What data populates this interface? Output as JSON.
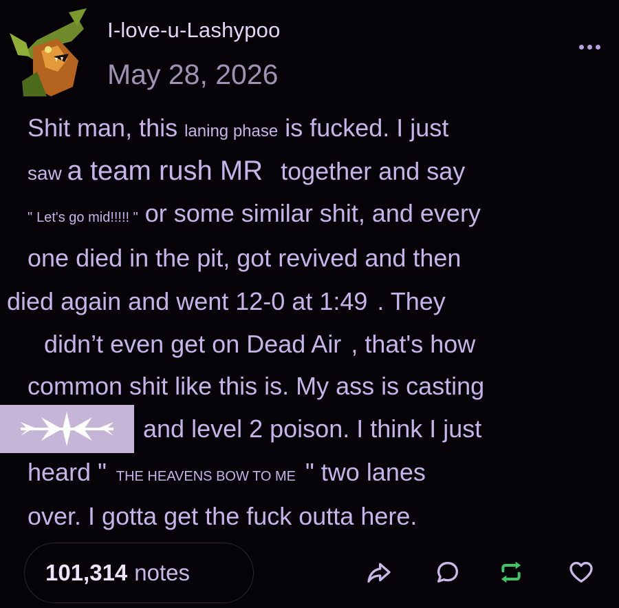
{
  "post": {
    "username": "I-love-u-Lashypoo",
    "date": "May 28, 2026",
    "body_lines": [
      [
        {
          "t": "Shit man, this ",
          "s": "n"
        },
        {
          "t": "laning phase",
          "s": "small"
        },
        {
          "t": " is fucked. I just",
          "s": "n"
        }
      ],
      [
        {
          "t": "saw ",
          "s": "small"
        },
        {
          "t": "a team rush MR",
          "s": "big"
        },
        {
          "t": "together and say",
          "s": "n"
        }
      ],
      [
        {
          "t": "\"",
          "s": "tiny"
        },
        {
          "t": "Let's go mid!!!!! \"",
          "s": "tiny"
        },
        {
          "t": "or some similar shit, and every",
          "s": "n"
        }
      ],
      [
        {
          "t": "one died in the pit, got revived and then",
          "s": "n"
        }
      ],
      [
        {
          "t": "died again and went 12-0 at 1:49",
          "s": "n"
        },
        {
          "t": ". They",
          "s": "n"
        }
      ],
      [
        {
          "t": "didn’t even get on Dead Air",
          "s": "n"
        },
        {
          "t": ", that's how",
          "s": "n"
        }
      ],
      [
        {
          "t": "common shit like this is. My ass is casting",
          "s": "n"
        }
      ],
      [
        {
          "t": "and level 2 poison. I think I just",
          "s": "n"
        }
      ],
      [
        {
          "t": "heard \"",
          "s": "n"
        },
        {
          "t": "THE HEAVENS BOW TO ME",
          "s": "tiny"
        },
        {
          "t": "\" two lanes",
          "s": "n"
        }
      ],
      [
        {
          "t": "over. I gotta get the fuck outta here.",
          "s": "n"
        }
      ]
    ]
  },
  "footer": {
    "notes_count": "101,314",
    "notes_label": "notes"
  },
  "icons": {
    "more": "more-dots-icon",
    "share": "share-icon",
    "reply": "reply-icon",
    "reblog": "reblog-icon",
    "like": "heart-icon"
  },
  "colors": {
    "background": "#050307",
    "text": "#c6b4ea",
    "date": "#9e93b4",
    "reblog": "#3fc767",
    "accent": "#b7a3e0"
  }
}
